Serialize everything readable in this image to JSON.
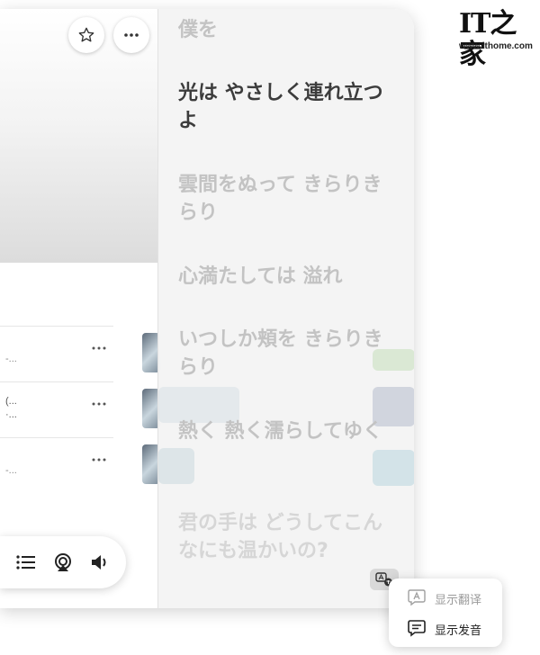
{
  "header": {
    "favorite_icon": "star-outline-icon",
    "more_icon": "ellipsis-icon"
  },
  "track_rows": [
    {
      "subtitle": "-..."
    },
    {
      "subtitle": "(...\n·..."
    },
    {
      "subtitle": "-..."
    }
  ],
  "player_controls": [
    {
      "name": "queue-list-icon"
    },
    {
      "name": "airplay-icon"
    },
    {
      "name": "volume-icon"
    }
  ],
  "lyrics": {
    "lines": [
      {
        "text": "僕を",
        "state": "past"
      },
      {
        "text": "光は やさしく連れ立つよ",
        "state": "current"
      },
      {
        "text": "雲間をぬって きらりきらり",
        "state": "upcoming"
      },
      {
        "text": "心満たしては 溢れ",
        "state": "upcoming"
      },
      {
        "text": "いつしか頬を きらりきらり",
        "state": "upcoming"
      },
      {
        "text": "熱く 熱く濡らしてゆく",
        "state": "upcoming"
      },
      {
        "text": "君の手は どうしてこんなにも温かいの?",
        "state": "upcoming"
      }
    ],
    "toggle_icon": "lyrics-translate-icon"
  },
  "popup_menu": {
    "items": [
      {
        "label": "显示翻译",
        "icon": "translate-a-icon",
        "enabled": false
      },
      {
        "label": "显示发音",
        "icon": "pronunciation-bubble-icon",
        "enabled": true
      }
    ]
  },
  "watermark": {
    "logo_text": "IT之家",
    "url": "www.ithome.com"
  },
  "colors": {
    "lyric_current": "#3c3c3c",
    "lyric_dim": "#c3c3c3",
    "menu_enabled": "#222222",
    "menu_disabled": "#9a9a9a"
  }
}
